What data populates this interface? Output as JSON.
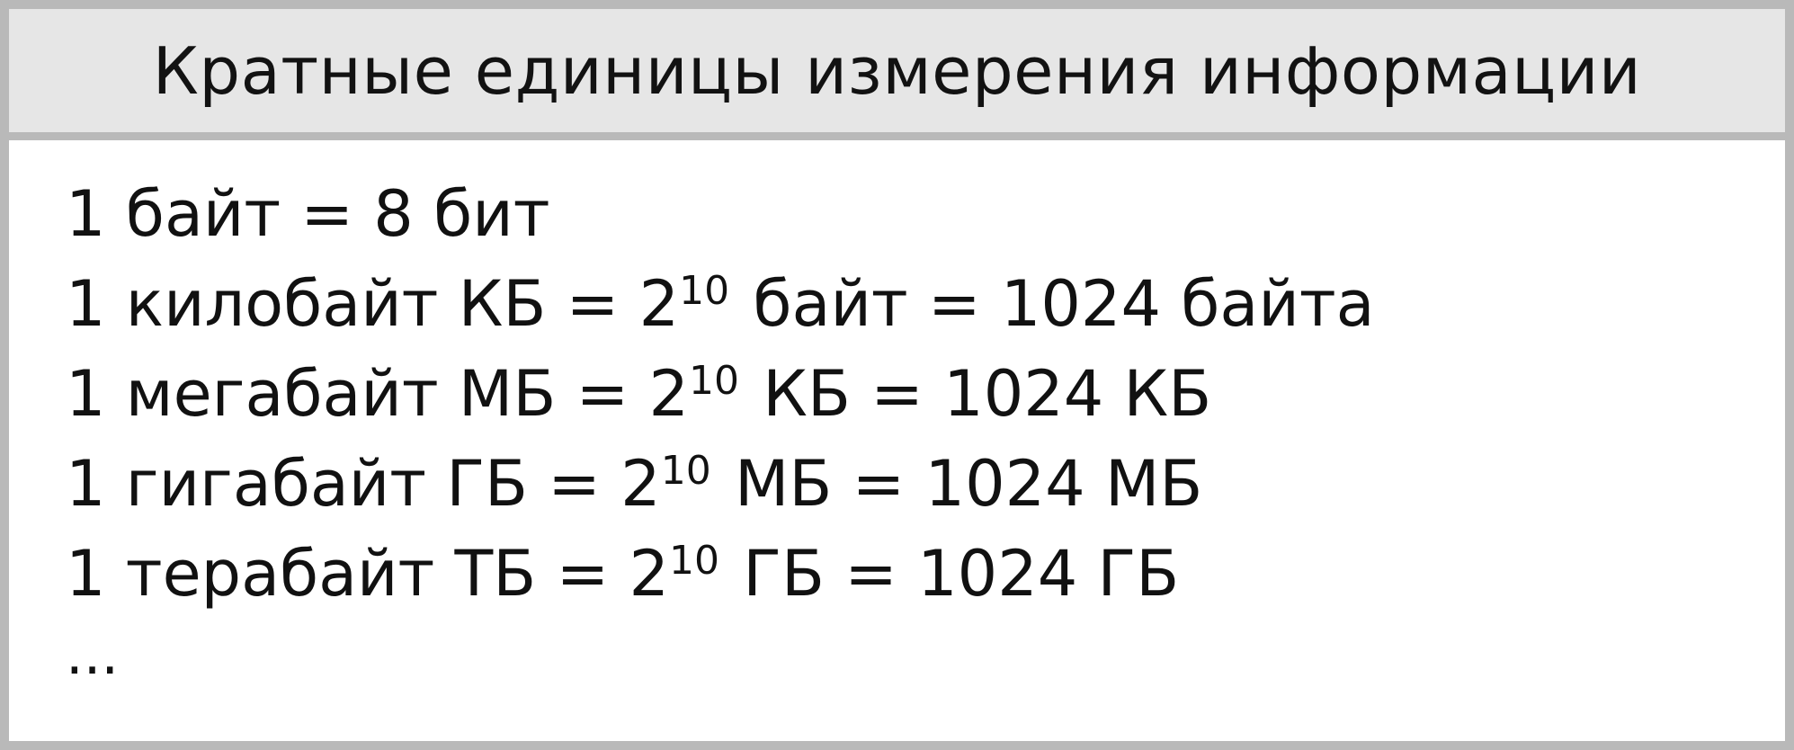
{
  "header": {
    "title": "Кратные единицы измерения информации"
  },
  "lines": [
    {
      "text": "1 байт = 8 бит"
    },
    {
      "pre": "1 килобайт КБ = 2",
      "exp": "10",
      "post": " байт = 1024 байта"
    },
    {
      "pre": "1 мегабайт МБ = 2",
      "exp": "10",
      "post": " КБ = 1024 КБ"
    },
    {
      "pre": "1 гигабайт ГБ = 2",
      "exp": "10",
      "post": " МБ = 1024 МБ"
    },
    {
      "pre": "1 терабайт ТБ = 2",
      "exp": "10",
      "post": " ГБ = 1024 ГБ"
    }
  ],
  "ellipsis": "..."
}
